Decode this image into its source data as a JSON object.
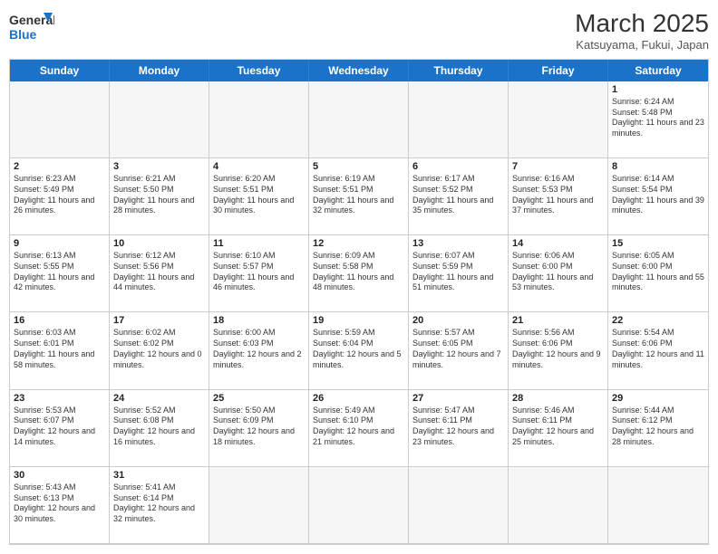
{
  "header": {
    "logo_general": "General",
    "logo_blue": "Blue",
    "month_title": "March 2025",
    "subtitle": "Katsuyama, Fukui, Japan"
  },
  "days_of_week": [
    "Sunday",
    "Monday",
    "Tuesday",
    "Wednesday",
    "Thursday",
    "Friday",
    "Saturday"
  ],
  "cells": [
    {
      "day": "",
      "empty": true,
      "text": ""
    },
    {
      "day": "",
      "empty": true,
      "text": ""
    },
    {
      "day": "",
      "empty": true,
      "text": ""
    },
    {
      "day": "",
      "empty": true,
      "text": ""
    },
    {
      "day": "",
      "empty": true,
      "text": ""
    },
    {
      "day": "",
      "empty": true,
      "text": ""
    },
    {
      "day": "1",
      "empty": false,
      "text": "Sunrise: 6:24 AM\nSunset: 5:48 PM\nDaylight: 11 hours and 23 minutes."
    },
    {
      "day": "2",
      "empty": false,
      "text": "Sunrise: 6:23 AM\nSunset: 5:49 PM\nDaylight: 11 hours and 26 minutes."
    },
    {
      "day": "3",
      "empty": false,
      "text": "Sunrise: 6:21 AM\nSunset: 5:50 PM\nDaylight: 11 hours and 28 minutes."
    },
    {
      "day": "4",
      "empty": false,
      "text": "Sunrise: 6:20 AM\nSunset: 5:51 PM\nDaylight: 11 hours and 30 minutes."
    },
    {
      "day": "5",
      "empty": false,
      "text": "Sunrise: 6:19 AM\nSunset: 5:51 PM\nDaylight: 11 hours and 32 minutes."
    },
    {
      "day": "6",
      "empty": false,
      "text": "Sunrise: 6:17 AM\nSunset: 5:52 PM\nDaylight: 11 hours and 35 minutes."
    },
    {
      "day": "7",
      "empty": false,
      "text": "Sunrise: 6:16 AM\nSunset: 5:53 PM\nDaylight: 11 hours and 37 minutes."
    },
    {
      "day": "8",
      "empty": false,
      "text": "Sunrise: 6:14 AM\nSunset: 5:54 PM\nDaylight: 11 hours and 39 minutes."
    },
    {
      "day": "9",
      "empty": false,
      "text": "Sunrise: 6:13 AM\nSunset: 5:55 PM\nDaylight: 11 hours and 42 minutes."
    },
    {
      "day": "10",
      "empty": false,
      "text": "Sunrise: 6:12 AM\nSunset: 5:56 PM\nDaylight: 11 hours and 44 minutes."
    },
    {
      "day": "11",
      "empty": false,
      "text": "Sunrise: 6:10 AM\nSunset: 5:57 PM\nDaylight: 11 hours and 46 minutes."
    },
    {
      "day": "12",
      "empty": false,
      "text": "Sunrise: 6:09 AM\nSunset: 5:58 PM\nDaylight: 11 hours and 48 minutes."
    },
    {
      "day": "13",
      "empty": false,
      "text": "Sunrise: 6:07 AM\nSunset: 5:59 PM\nDaylight: 11 hours and 51 minutes."
    },
    {
      "day": "14",
      "empty": false,
      "text": "Sunrise: 6:06 AM\nSunset: 6:00 PM\nDaylight: 11 hours and 53 minutes."
    },
    {
      "day": "15",
      "empty": false,
      "text": "Sunrise: 6:05 AM\nSunset: 6:00 PM\nDaylight: 11 hours and 55 minutes."
    },
    {
      "day": "16",
      "empty": false,
      "text": "Sunrise: 6:03 AM\nSunset: 6:01 PM\nDaylight: 11 hours and 58 minutes."
    },
    {
      "day": "17",
      "empty": false,
      "text": "Sunrise: 6:02 AM\nSunset: 6:02 PM\nDaylight: 12 hours and 0 minutes."
    },
    {
      "day": "18",
      "empty": false,
      "text": "Sunrise: 6:00 AM\nSunset: 6:03 PM\nDaylight: 12 hours and 2 minutes."
    },
    {
      "day": "19",
      "empty": false,
      "text": "Sunrise: 5:59 AM\nSunset: 6:04 PM\nDaylight: 12 hours and 5 minutes."
    },
    {
      "day": "20",
      "empty": false,
      "text": "Sunrise: 5:57 AM\nSunset: 6:05 PM\nDaylight: 12 hours and 7 minutes."
    },
    {
      "day": "21",
      "empty": false,
      "text": "Sunrise: 5:56 AM\nSunset: 6:06 PM\nDaylight: 12 hours and 9 minutes."
    },
    {
      "day": "22",
      "empty": false,
      "text": "Sunrise: 5:54 AM\nSunset: 6:06 PM\nDaylight: 12 hours and 11 minutes."
    },
    {
      "day": "23",
      "empty": false,
      "text": "Sunrise: 5:53 AM\nSunset: 6:07 PM\nDaylight: 12 hours and 14 minutes."
    },
    {
      "day": "24",
      "empty": false,
      "text": "Sunrise: 5:52 AM\nSunset: 6:08 PM\nDaylight: 12 hours and 16 minutes."
    },
    {
      "day": "25",
      "empty": false,
      "text": "Sunrise: 5:50 AM\nSunset: 6:09 PM\nDaylight: 12 hours and 18 minutes."
    },
    {
      "day": "26",
      "empty": false,
      "text": "Sunrise: 5:49 AM\nSunset: 6:10 PM\nDaylight: 12 hours and 21 minutes."
    },
    {
      "day": "27",
      "empty": false,
      "text": "Sunrise: 5:47 AM\nSunset: 6:11 PM\nDaylight: 12 hours and 23 minutes."
    },
    {
      "day": "28",
      "empty": false,
      "text": "Sunrise: 5:46 AM\nSunset: 6:11 PM\nDaylight: 12 hours and 25 minutes."
    },
    {
      "day": "29",
      "empty": false,
      "text": "Sunrise: 5:44 AM\nSunset: 6:12 PM\nDaylight: 12 hours and 28 minutes."
    },
    {
      "day": "30",
      "empty": false,
      "text": "Sunrise: 5:43 AM\nSunset: 6:13 PM\nDaylight: 12 hours and 30 minutes."
    },
    {
      "day": "31",
      "empty": false,
      "text": "Sunrise: 5:41 AM\nSunset: 6:14 PM\nDaylight: 12 hours and 32 minutes."
    },
    {
      "day": "",
      "empty": true,
      "text": ""
    },
    {
      "day": "",
      "empty": true,
      "text": ""
    },
    {
      "day": "",
      "empty": true,
      "text": ""
    },
    {
      "day": "",
      "empty": true,
      "text": ""
    },
    {
      "day": "",
      "empty": true,
      "text": ""
    }
  ]
}
